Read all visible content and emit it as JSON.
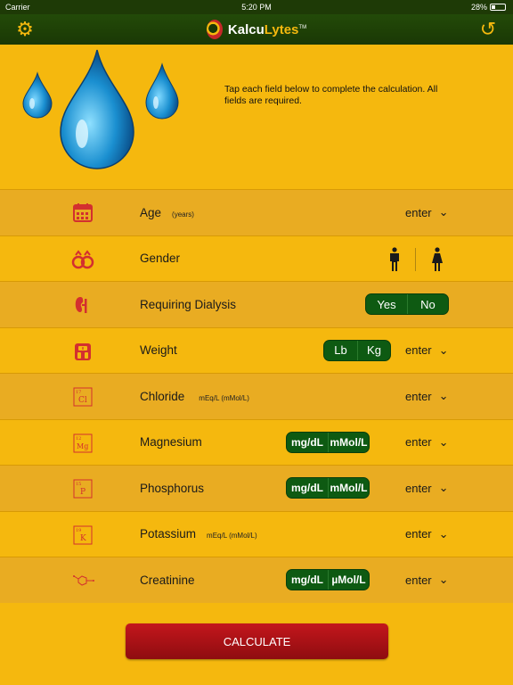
{
  "status": {
    "carrier": "Carrier",
    "time": "5:20 PM",
    "battery": "28%"
  },
  "nav": {
    "app_name_1": "Kalcu",
    "app_name_2": "Lytes",
    "tm": "TM"
  },
  "header": {
    "instructions": "Tap each field below to complete the calculation. All fields are required."
  },
  "rows": {
    "age": {
      "label": "Age",
      "unit": "(years)",
      "enter": "enter"
    },
    "gender": {
      "label": "Gender"
    },
    "dialysis": {
      "label": "Requiring Dialysis",
      "options": [
        "Yes",
        "No"
      ]
    },
    "weight": {
      "label": "Weight",
      "options": [
        "Lb",
        "Kg"
      ],
      "enter": "enter"
    },
    "chloride": {
      "label": "Chloride",
      "unit": "mEq/L (mMol/L)",
      "enter": "enter",
      "element_num": "17",
      "element_sym": "Cl"
    },
    "magnesium": {
      "label": "Magnesium",
      "options": [
        "mg/dL",
        "mMol/L"
      ],
      "enter": "enter",
      "element_num": "12",
      "element_sym": "Mg"
    },
    "phosphorus": {
      "label": "Phosphorus",
      "options": [
        "mg/dL",
        "mMol/L"
      ],
      "enter": "enter",
      "element_num": "15",
      "element_sym": "P"
    },
    "potassium": {
      "label": "Potassium",
      "unit": "mEq/L (mMol/L)",
      "enter": "enter",
      "element_num": "19",
      "element_sym": "K"
    },
    "creatinine": {
      "label": "Creatinine",
      "options": [
        "mg/dL",
        "µMol/L"
      ],
      "enter": "enter"
    }
  },
  "calculate_label": "CALCULATE",
  "colors": {
    "background": "#f5b80e",
    "nav": "#1a3805",
    "toggle": "#0e5a12",
    "button": "#b01218",
    "icon_red": "#d32f2f"
  }
}
